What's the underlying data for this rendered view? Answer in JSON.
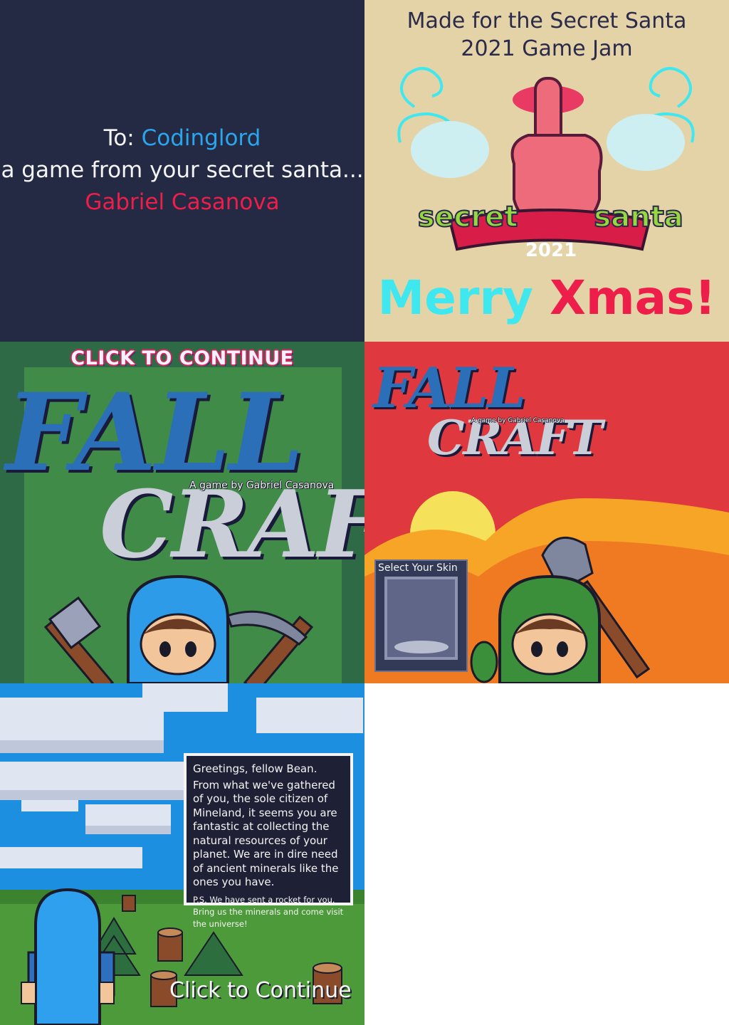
{
  "intro": {
    "to_label": "To:",
    "recipient": "Codinglord",
    "message": "a game from your secret santa...",
    "author": "Gabriel Casanova"
  },
  "jam": {
    "line1": "Made for the Secret Santa",
    "line2": "2021 Game Jam",
    "logo_left": "secret",
    "logo_right": "santa",
    "logo_year": "2021",
    "greet_a": "Merry",
    "greet_b": "Xmas!"
  },
  "title_screen": {
    "prompt": "CLICK TO CONTINUE",
    "title_word1": "FALL",
    "title_word2": "CRAFT",
    "byline": "A game by Gabriel Casanova"
  },
  "skin_screen": {
    "title_word1": "FALL",
    "title_word2": "CRAFT",
    "byline": "A game by Gabriel Casanova",
    "select_label": "Select Your Skin"
  },
  "story_screen": {
    "greeting": "Greetings, fellow Bean.",
    "body": "From what we've gathered of you, the sole citizen of Mineland, it seems you are fantastic at collecting the natural resources of your planet. We are in dire need of ancient minerals like the ones you have.",
    "ps": "P.S. We have sent a rocket for you. Bring us the minerals and come visit the universe!",
    "continue": "Click to Continue"
  },
  "colors": {
    "accent_blue": "#2aa6ee",
    "accent_red": "#ee1e4a",
    "accent_cyan": "#3fe7ef",
    "panel_navy": "#242944",
    "panel_tan": "#e5d3a8",
    "panel_green": "#2e6a45",
    "panel_red": "#e0383f",
    "sky_blue": "#1d8fe0"
  },
  "icons": [
    "shush-hand-icon",
    "axe-icon",
    "pickaxe-icon",
    "shovel-icon",
    "bean-character-icon",
    "sun-icon",
    "pine-tree-icon",
    "tree-stump-icon"
  ]
}
